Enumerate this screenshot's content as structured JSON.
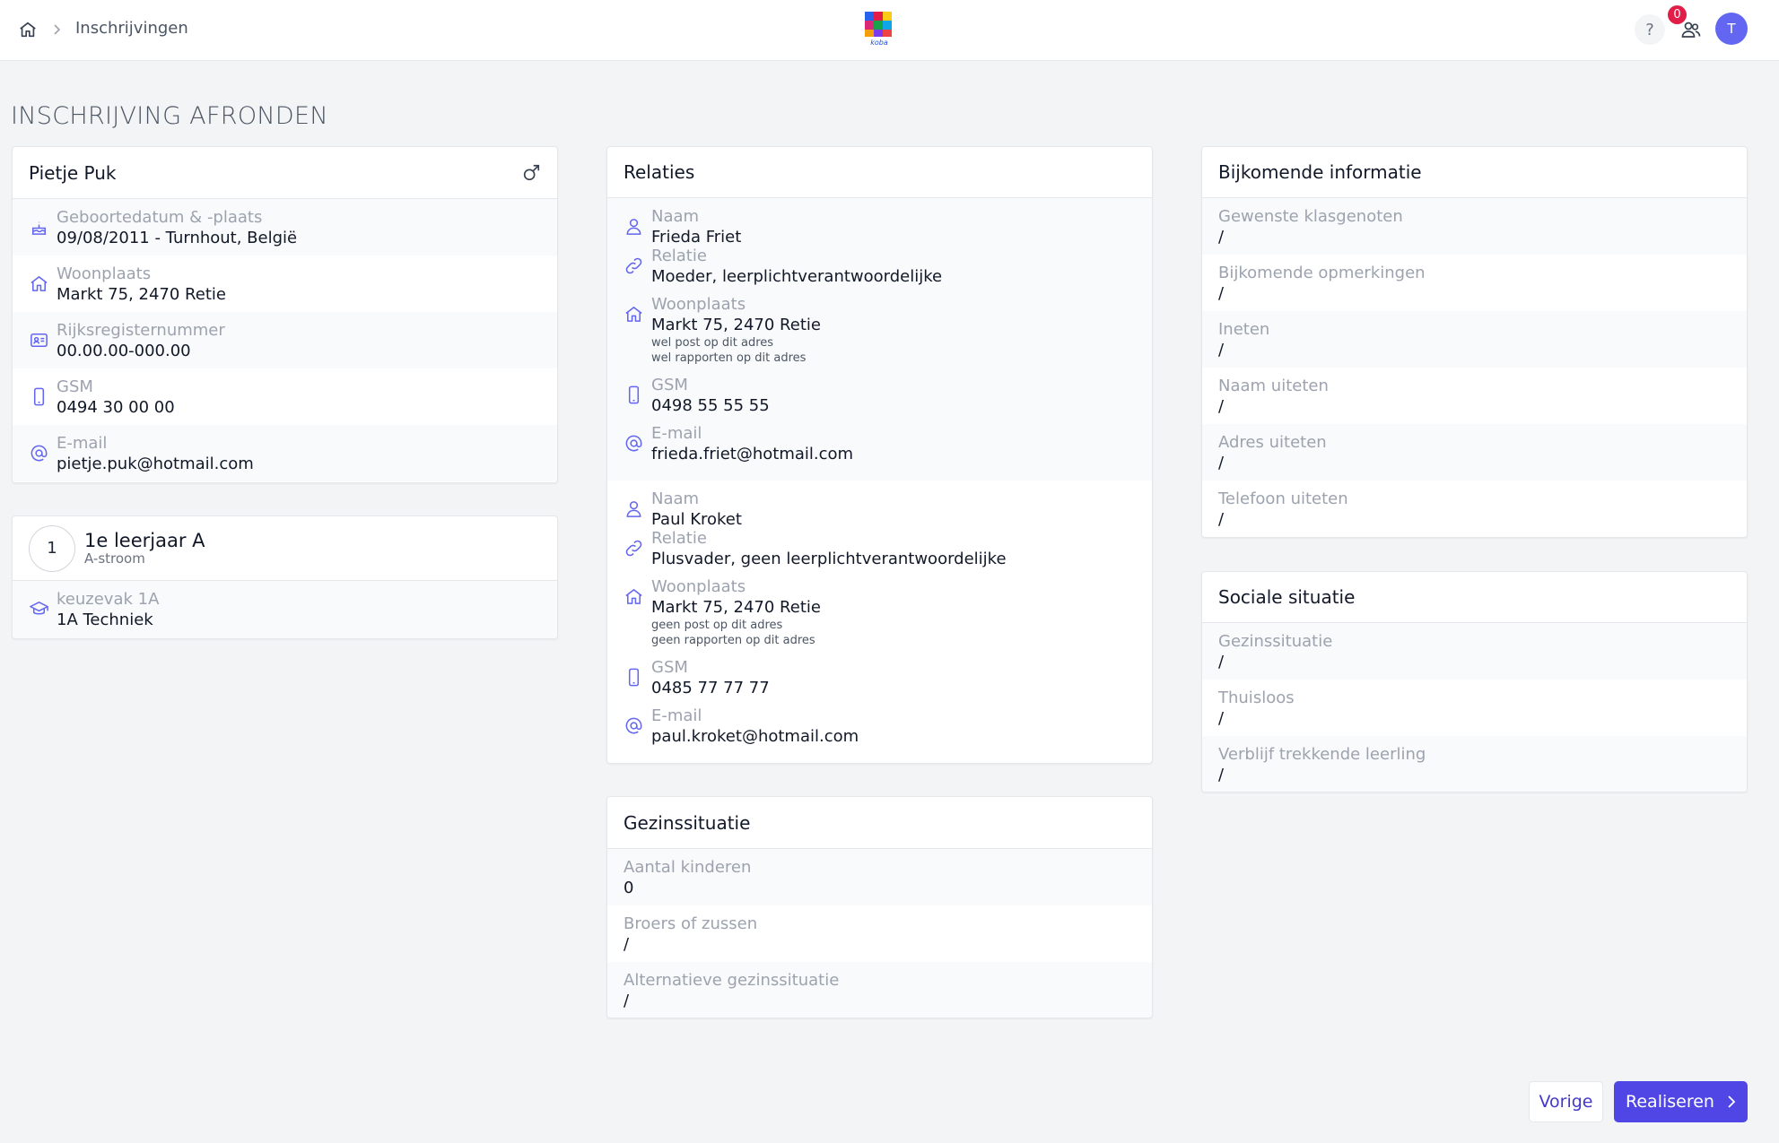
{
  "header": {
    "breadcrumb": "Inschrijvingen",
    "logo_text": "koba",
    "help_label": "?",
    "notification_count": "0",
    "avatar_initial": "T"
  },
  "page_title": "INSCHRIJVING AFRONDEN",
  "student": {
    "name": "Pietje Puk",
    "gender_icon": "male-icon",
    "fields": [
      {
        "icon": "cake-icon",
        "label": "Geboortedatum & -plaats",
        "value": "09/08/2011 - Turnhout, België"
      },
      {
        "icon": "home-icon",
        "label": "Woonplaats",
        "value": "Markt 75, 2470 Retie"
      },
      {
        "icon": "id-card-icon",
        "label": "Rijksregisternummer",
        "value": "00.00.00-000.00"
      },
      {
        "icon": "phone-icon",
        "label": "GSM",
        "value": "0494 30 00 00"
      },
      {
        "icon": "at-icon",
        "label": "E-mail",
        "value": "pietje.puk@hotmail.com"
      }
    ]
  },
  "grade": {
    "number": "1",
    "title": "1e leerjaar A",
    "subtitle": "A-stroom",
    "option_label": "keuzevak 1A",
    "option_value": "1A Techniek"
  },
  "relations": {
    "title": "Relaties",
    "people": [
      {
        "name_label": "Naam",
        "name": "Frieda Friet",
        "relation_label": "Relatie",
        "relation": "Moeder, leerplichtverantwoordelijke",
        "address_label": "Woonplaats",
        "address": "Markt 75, 2470 Retie",
        "note1": "wel post op dit adres",
        "note2": "wel rapporten op dit adres",
        "phone_label": "GSM",
        "phone": "0498 55 55 55",
        "email_label": "E-mail",
        "email": "frieda.friet@hotmail.com"
      },
      {
        "name_label": "Naam",
        "name": "Paul Kroket",
        "relation_label": "Relatie",
        "relation": "Plusvader, geen leerplichtverantwoordelijke",
        "address_label": "Woonplaats",
        "address": "Markt 75, 2470 Retie",
        "note1": "geen post op dit adres",
        "note2": "geen rapporten op dit adres",
        "phone_label": "GSM",
        "phone": "0485 77 77 77",
        "email_label": "E-mail",
        "email": "paul.kroket@hotmail.com"
      }
    ]
  },
  "family": {
    "title": "Gezinssituatie",
    "fields": [
      {
        "label": "Aantal kinderen",
        "value": "0"
      },
      {
        "label": "Broers of zussen",
        "value": "/"
      },
      {
        "label": "Alternatieve gezinssituatie",
        "value": "/"
      }
    ]
  },
  "extra": {
    "title": "Bijkomende informatie",
    "fields": [
      {
        "label": "Gewenste klasgenoten",
        "value": "/"
      },
      {
        "label": "Bijkomende opmerkingen",
        "value": "/"
      },
      {
        "label": "Ineten",
        "value": "/"
      },
      {
        "label": "Naam uiteten",
        "value": "/"
      },
      {
        "label": "Adres uiteten",
        "value": "/"
      },
      {
        "label": "Telefoon uiteten",
        "value": "/"
      }
    ]
  },
  "social": {
    "title": "Sociale situatie",
    "fields": [
      {
        "label": "Gezinssituatie",
        "value": "/"
      },
      {
        "label": "Thuisloos",
        "value": "/"
      },
      {
        "label": "Verblijf trekkende leerling",
        "value": "/"
      }
    ]
  },
  "actions": {
    "prev_label": "Vorige",
    "next_label": "Realiseren"
  },
  "colors": {
    "accent": "#4f46e5",
    "icon": "#6366f1",
    "badge": "#e11d48"
  }
}
